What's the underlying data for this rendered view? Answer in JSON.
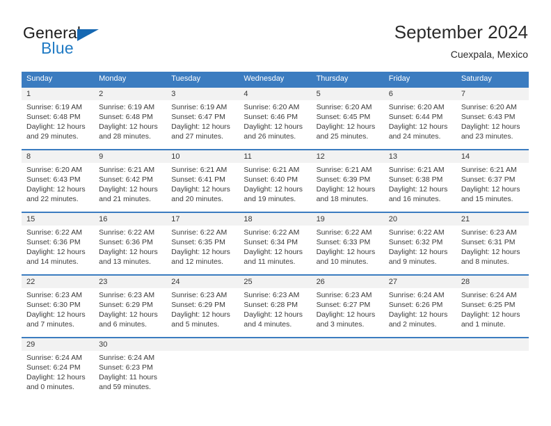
{
  "brand": {
    "name_primary": "General",
    "name_secondary": "Blue",
    "flag_icon": "triangle-flag-icon",
    "primary_color": "#1b1b1b",
    "secondary_color": "#1f7ac4",
    "flag_color": "#1668b2"
  },
  "header": {
    "title": "September 2024",
    "subtitle": "Cuexpala, Mexico"
  },
  "theme": {
    "header_bg": "#3b7cc0",
    "header_text": "#ffffff",
    "date_band_bg": "#f2f2f2",
    "cell_bg": "#ffffff",
    "divider": "#3b7cc0",
    "body_text": "#3a3a3a"
  },
  "calendar": {
    "weekdays": [
      "Sunday",
      "Monday",
      "Tuesday",
      "Wednesday",
      "Thursday",
      "Friday",
      "Saturday"
    ],
    "weeks": [
      [
        {
          "date": "1",
          "sunrise": "Sunrise: 6:19 AM",
          "sunset": "Sunset: 6:48 PM",
          "daylight_1": "Daylight: 12 hours",
          "daylight_2": "and 29 minutes."
        },
        {
          "date": "2",
          "sunrise": "Sunrise: 6:19 AM",
          "sunset": "Sunset: 6:48 PM",
          "daylight_1": "Daylight: 12 hours",
          "daylight_2": "and 28 minutes."
        },
        {
          "date": "3",
          "sunrise": "Sunrise: 6:19 AM",
          "sunset": "Sunset: 6:47 PM",
          "daylight_1": "Daylight: 12 hours",
          "daylight_2": "and 27 minutes."
        },
        {
          "date": "4",
          "sunrise": "Sunrise: 6:20 AM",
          "sunset": "Sunset: 6:46 PM",
          "daylight_1": "Daylight: 12 hours",
          "daylight_2": "and 26 minutes."
        },
        {
          "date": "5",
          "sunrise": "Sunrise: 6:20 AM",
          "sunset": "Sunset: 6:45 PM",
          "daylight_1": "Daylight: 12 hours",
          "daylight_2": "and 25 minutes."
        },
        {
          "date": "6",
          "sunrise": "Sunrise: 6:20 AM",
          "sunset": "Sunset: 6:44 PM",
          "daylight_1": "Daylight: 12 hours",
          "daylight_2": "and 24 minutes."
        },
        {
          "date": "7",
          "sunrise": "Sunrise: 6:20 AM",
          "sunset": "Sunset: 6:43 PM",
          "daylight_1": "Daylight: 12 hours",
          "daylight_2": "and 23 minutes."
        }
      ],
      [
        {
          "date": "8",
          "sunrise": "Sunrise: 6:20 AM",
          "sunset": "Sunset: 6:43 PM",
          "daylight_1": "Daylight: 12 hours",
          "daylight_2": "and 22 minutes."
        },
        {
          "date": "9",
          "sunrise": "Sunrise: 6:21 AM",
          "sunset": "Sunset: 6:42 PM",
          "daylight_1": "Daylight: 12 hours",
          "daylight_2": "and 21 minutes."
        },
        {
          "date": "10",
          "sunrise": "Sunrise: 6:21 AM",
          "sunset": "Sunset: 6:41 PM",
          "daylight_1": "Daylight: 12 hours",
          "daylight_2": "and 20 minutes."
        },
        {
          "date": "11",
          "sunrise": "Sunrise: 6:21 AM",
          "sunset": "Sunset: 6:40 PM",
          "daylight_1": "Daylight: 12 hours",
          "daylight_2": "and 19 minutes."
        },
        {
          "date": "12",
          "sunrise": "Sunrise: 6:21 AM",
          "sunset": "Sunset: 6:39 PM",
          "daylight_1": "Daylight: 12 hours",
          "daylight_2": "and 18 minutes."
        },
        {
          "date": "13",
          "sunrise": "Sunrise: 6:21 AM",
          "sunset": "Sunset: 6:38 PM",
          "daylight_1": "Daylight: 12 hours",
          "daylight_2": "and 16 minutes."
        },
        {
          "date": "14",
          "sunrise": "Sunrise: 6:21 AM",
          "sunset": "Sunset: 6:37 PM",
          "daylight_1": "Daylight: 12 hours",
          "daylight_2": "and 15 minutes."
        }
      ],
      [
        {
          "date": "15",
          "sunrise": "Sunrise: 6:22 AM",
          "sunset": "Sunset: 6:36 PM",
          "daylight_1": "Daylight: 12 hours",
          "daylight_2": "and 14 minutes."
        },
        {
          "date": "16",
          "sunrise": "Sunrise: 6:22 AM",
          "sunset": "Sunset: 6:36 PM",
          "daylight_1": "Daylight: 12 hours",
          "daylight_2": "and 13 minutes."
        },
        {
          "date": "17",
          "sunrise": "Sunrise: 6:22 AM",
          "sunset": "Sunset: 6:35 PM",
          "daylight_1": "Daylight: 12 hours",
          "daylight_2": "and 12 minutes."
        },
        {
          "date": "18",
          "sunrise": "Sunrise: 6:22 AM",
          "sunset": "Sunset: 6:34 PM",
          "daylight_1": "Daylight: 12 hours",
          "daylight_2": "and 11 minutes."
        },
        {
          "date": "19",
          "sunrise": "Sunrise: 6:22 AM",
          "sunset": "Sunset: 6:33 PM",
          "daylight_1": "Daylight: 12 hours",
          "daylight_2": "and 10 minutes."
        },
        {
          "date": "20",
          "sunrise": "Sunrise: 6:22 AM",
          "sunset": "Sunset: 6:32 PM",
          "daylight_1": "Daylight: 12 hours",
          "daylight_2": "and 9 minutes."
        },
        {
          "date": "21",
          "sunrise": "Sunrise: 6:23 AM",
          "sunset": "Sunset: 6:31 PM",
          "daylight_1": "Daylight: 12 hours",
          "daylight_2": "and 8 minutes."
        }
      ],
      [
        {
          "date": "22",
          "sunrise": "Sunrise: 6:23 AM",
          "sunset": "Sunset: 6:30 PM",
          "daylight_1": "Daylight: 12 hours",
          "daylight_2": "and 7 minutes."
        },
        {
          "date": "23",
          "sunrise": "Sunrise: 6:23 AM",
          "sunset": "Sunset: 6:29 PM",
          "daylight_1": "Daylight: 12 hours",
          "daylight_2": "and 6 minutes."
        },
        {
          "date": "24",
          "sunrise": "Sunrise: 6:23 AM",
          "sunset": "Sunset: 6:29 PM",
          "daylight_1": "Daylight: 12 hours",
          "daylight_2": "and 5 minutes."
        },
        {
          "date": "25",
          "sunrise": "Sunrise: 6:23 AM",
          "sunset": "Sunset: 6:28 PM",
          "daylight_1": "Daylight: 12 hours",
          "daylight_2": "and 4 minutes."
        },
        {
          "date": "26",
          "sunrise": "Sunrise: 6:23 AM",
          "sunset": "Sunset: 6:27 PM",
          "daylight_1": "Daylight: 12 hours",
          "daylight_2": "and 3 minutes."
        },
        {
          "date": "27",
          "sunrise": "Sunrise: 6:24 AM",
          "sunset": "Sunset: 6:26 PM",
          "daylight_1": "Daylight: 12 hours",
          "daylight_2": "and 2 minutes."
        },
        {
          "date": "28",
          "sunrise": "Sunrise: 6:24 AM",
          "sunset": "Sunset: 6:25 PM",
          "daylight_1": "Daylight: 12 hours",
          "daylight_2": "and 1 minute."
        }
      ],
      [
        {
          "date": "29",
          "sunrise": "Sunrise: 6:24 AM",
          "sunset": "Sunset: 6:24 PM",
          "daylight_1": "Daylight: 12 hours",
          "daylight_2": "and 0 minutes."
        },
        {
          "date": "30",
          "sunrise": "Sunrise: 6:24 AM",
          "sunset": "Sunset: 6:23 PM",
          "daylight_1": "Daylight: 11 hours",
          "daylight_2": "and 59 minutes."
        },
        {
          "date": "",
          "sunrise": "",
          "sunset": "",
          "daylight_1": "",
          "daylight_2": ""
        },
        {
          "date": "",
          "sunrise": "",
          "sunset": "",
          "daylight_1": "",
          "daylight_2": ""
        },
        {
          "date": "",
          "sunrise": "",
          "sunset": "",
          "daylight_1": "",
          "daylight_2": ""
        },
        {
          "date": "",
          "sunrise": "",
          "sunset": "",
          "daylight_1": "",
          "daylight_2": ""
        },
        {
          "date": "",
          "sunrise": "",
          "sunset": "",
          "daylight_1": "",
          "daylight_2": ""
        }
      ]
    ]
  }
}
